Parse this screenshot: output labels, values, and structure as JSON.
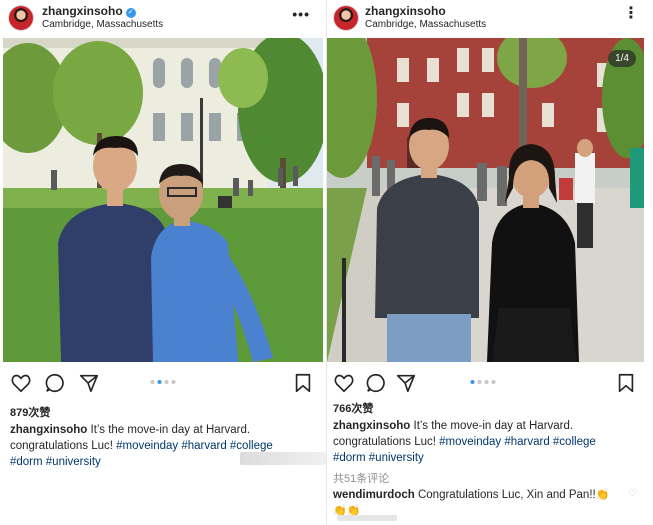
{
  "left_post": {
    "username": "zhangxinsoho",
    "verified": true,
    "location": "Cambridge, Massachusetts",
    "more_icon": "more-horizontal-icon",
    "carousel_dots": 4,
    "active_dot": 1,
    "likes": "879次赞",
    "caption_user": "zhangxinsoho",
    "caption_text": " It’s the move-in day at Harvard. congratulations Luc! ",
    "hashtags_line1": "#moveinday #harvard #college",
    "hashtags_line2": "#dorm #university"
  },
  "right_post": {
    "username": "zhangxinsoho",
    "location": "Cambridge, Massachusetts",
    "more_icon": "more-vertical-icon",
    "photo_counter": "1/4",
    "carousel_dots": 4,
    "active_dot": 0,
    "likes": "766次赞",
    "caption_user": "zhangxinsoho",
    "caption_text": " It’s the move-in day at Harvard. congratulations Luc! ",
    "hashtags_line1": "#moveinday #harvard #college",
    "hashtags_line2": "#dorm #university",
    "comments_count": "共51条评论",
    "comment_user": "wendimurdoch",
    "comment_text": " Congratulations Luc, Xin and Pan!!"
  },
  "icons": {
    "like": "heart-icon",
    "comment": "comment-icon",
    "share": "share-icon",
    "save": "bookmark-icon"
  },
  "colors": {
    "verified": "#3897f0",
    "hashtag": "#00376b",
    "active_dot": "#3897f0",
    "muted_text": "#8e8e8e"
  }
}
